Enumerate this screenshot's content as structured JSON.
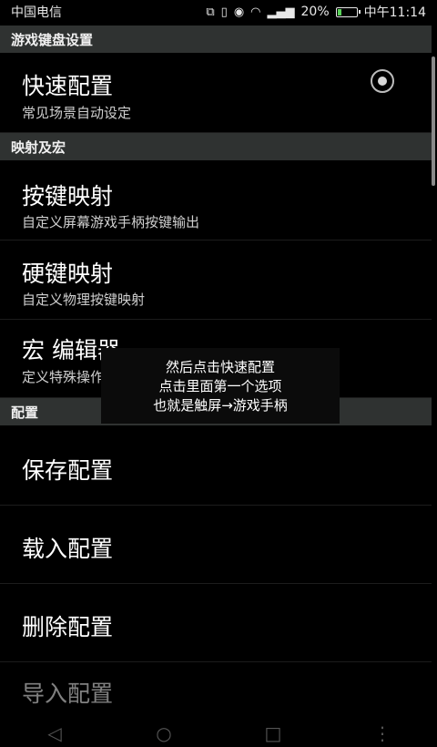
{
  "status": {
    "carrier": "中国电信",
    "battery_percent": "20%",
    "battery_level": 0.2,
    "time": "中午11:14",
    "icons": [
      "cast-icon",
      "vibrate-icon",
      "eye-icon",
      "wifi-icon",
      "signal-icon",
      "battery-icon"
    ]
  },
  "page_header": "游戏键盘设置",
  "quick_config": {
    "title": "快速配置",
    "subtitle": "常见场景自动设定",
    "selected": true
  },
  "section_mapping": {
    "label": "映射及宏",
    "items": [
      {
        "title": "按键映射",
        "subtitle": "自定义屏幕游戏手柄按键输出"
      },
      {
        "title": "硬键映射",
        "subtitle": "自定义物理按键映射"
      },
      {
        "title": "宏 编辑器",
        "subtitle": "定义特殊操作顺序"
      }
    ]
  },
  "section_config": {
    "label": "配置",
    "items": [
      {
        "title": "保存配置"
      },
      {
        "title": "载入配置"
      },
      {
        "title": "删除配置"
      },
      {
        "title": "导入配置"
      }
    ]
  },
  "overlay": {
    "lines": [
      "然后点击快速配置",
      "点击里面第一个选项",
      "也就是触屏→游戏手柄"
    ]
  },
  "nav": {
    "back": "◁",
    "home": "○",
    "recents": "□",
    "menu": "⋮"
  }
}
